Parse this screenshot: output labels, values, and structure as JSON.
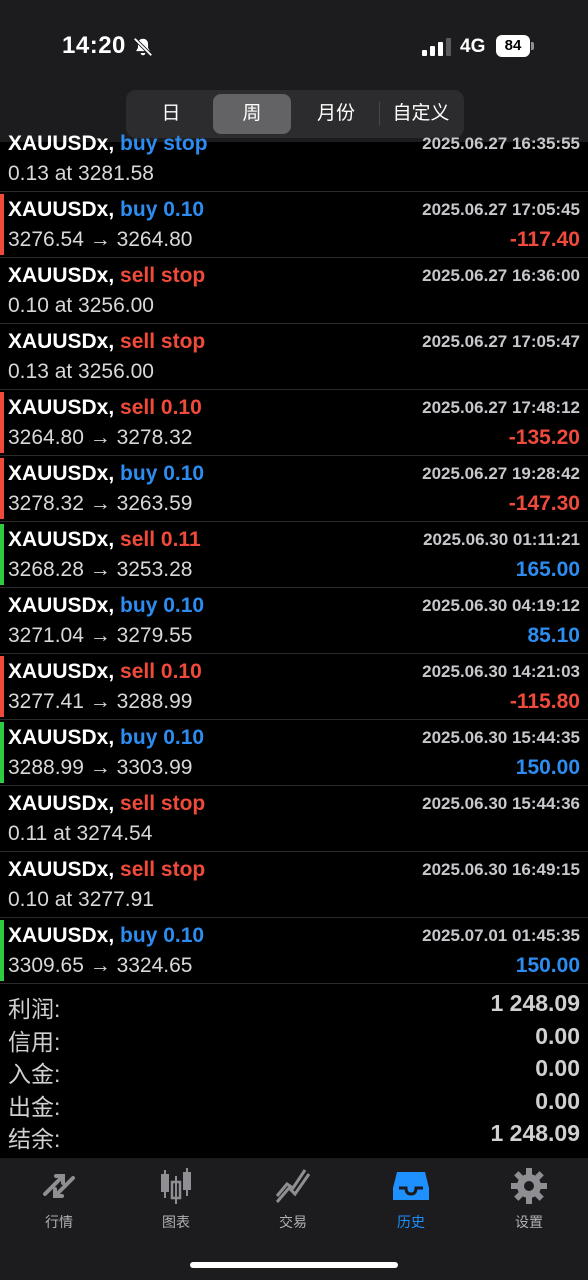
{
  "status": {
    "time": "14:20",
    "network": "4G",
    "battery": "84"
  },
  "period_tabs": {
    "items": [
      {
        "label": "日",
        "active": false
      },
      {
        "label": "周",
        "active": true
      },
      {
        "label": "月份",
        "active": false
      },
      {
        "label": "自定义",
        "active": false
      }
    ]
  },
  "top_partial": {
    "symbol": "XAUUSDx,",
    "side": "buy",
    "extra": "stop",
    "line2": "0.13 at 3281.58",
    "timestamp": "2025.06.27 16:35:55"
  },
  "deals": [
    {
      "symbol": "XAUUSDx,",
      "side": "buy",
      "extra": "0.10",
      "timestamp": "2025.06.27 17:05:45",
      "prices": "3276.54 → 3264.80",
      "profit": "-117.40",
      "marker": "#f04a3a"
    },
    {
      "symbol": "XAUUSDx,",
      "side": "sell",
      "extra": "stop",
      "timestamp": "2025.06.27 16:36:00",
      "prices": "0.10 at 3256.00",
      "profit": "",
      "marker": ""
    },
    {
      "symbol": "XAUUSDx,",
      "side": "sell",
      "extra": "stop",
      "timestamp": "2025.06.27 17:05:47",
      "prices": "0.13 at 3256.00",
      "profit": "",
      "marker": ""
    },
    {
      "symbol": "XAUUSDx,",
      "side": "sell",
      "extra": "0.10",
      "timestamp": "2025.06.27 17:48:12",
      "prices": "3264.80 → 3278.32",
      "profit": "-135.20",
      "marker": "#f04a3a"
    },
    {
      "symbol": "XAUUSDx,",
      "side": "buy",
      "extra": "0.10",
      "timestamp": "2025.06.27 19:28:42",
      "prices": "3278.32 → 3263.59",
      "profit": "-147.30",
      "marker": "#f04a3a"
    },
    {
      "symbol": "XAUUSDx,",
      "side": "sell",
      "extra": "0.11",
      "timestamp": "2025.06.30 01:11:21",
      "prices": "3268.28 → 3253.28",
      "profit": "165.00",
      "marker": "#2ecc40"
    },
    {
      "symbol": "XAUUSDx,",
      "side": "buy",
      "extra": "0.10",
      "timestamp": "2025.06.30 04:19:12",
      "prices": "3271.04 → 3279.55",
      "profit": "85.10",
      "marker": ""
    },
    {
      "symbol": "XAUUSDx,",
      "side": "sell",
      "extra": "0.10",
      "timestamp": "2025.06.30 14:21:03",
      "prices": "3277.41 → 3288.99",
      "profit": "-115.80",
      "marker": "#f04a3a"
    },
    {
      "symbol": "XAUUSDx,",
      "side": "buy",
      "extra": "0.10",
      "timestamp": "2025.06.30 15:44:35",
      "prices": "3288.99 → 3303.99",
      "profit": "150.00",
      "marker": "#2ecc40"
    },
    {
      "symbol": "XAUUSDx,",
      "side": "sell",
      "extra": "stop",
      "timestamp": "2025.06.30 15:44:36",
      "prices": "0.11 at 3274.54",
      "profit": "",
      "marker": ""
    },
    {
      "symbol": "XAUUSDx,",
      "side": "sell",
      "extra": "stop",
      "timestamp": "2025.06.30 16:49:15",
      "prices": "0.10 at 3277.91",
      "profit": "",
      "marker": ""
    },
    {
      "symbol": "XAUUSDx,",
      "side": "buy",
      "extra": "0.10",
      "timestamp": "2025.07.01 01:45:35",
      "prices": "3309.65 → 3324.65",
      "profit": "150.00",
      "marker": "#2ecc40"
    }
  ],
  "summary": [
    {
      "label": "利润:",
      "value": "1 248.09"
    },
    {
      "label": "信用:",
      "value": "0.00"
    },
    {
      "label": "入金:",
      "value": "0.00"
    },
    {
      "label": "出金:",
      "value": "0.00"
    },
    {
      "label": "结余:",
      "value": "1 248.09"
    }
  ],
  "nav": [
    {
      "label": "行情",
      "icon": "quotes-arrows-icon",
      "active": false
    },
    {
      "label": "图表",
      "icon": "candlestick-chart-icon",
      "active": false
    },
    {
      "label": "交易",
      "icon": "trade-line-icon",
      "active": false
    },
    {
      "label": "历史",
      "icon": "history-inbox-icon",
      "active": true
    },
    {
      "label": "设置",
      "icon": "gear-icon",
      "active": false
    }
  ],
  "colors": {
    "buy": "#2d8cf0",
    "sell": "#f04a3a",
    "profit_positive": "#2d8cf0",
    "profit_negative": "#ef4a3c",
    "nav_active": "#1e90ff"
  }
}
